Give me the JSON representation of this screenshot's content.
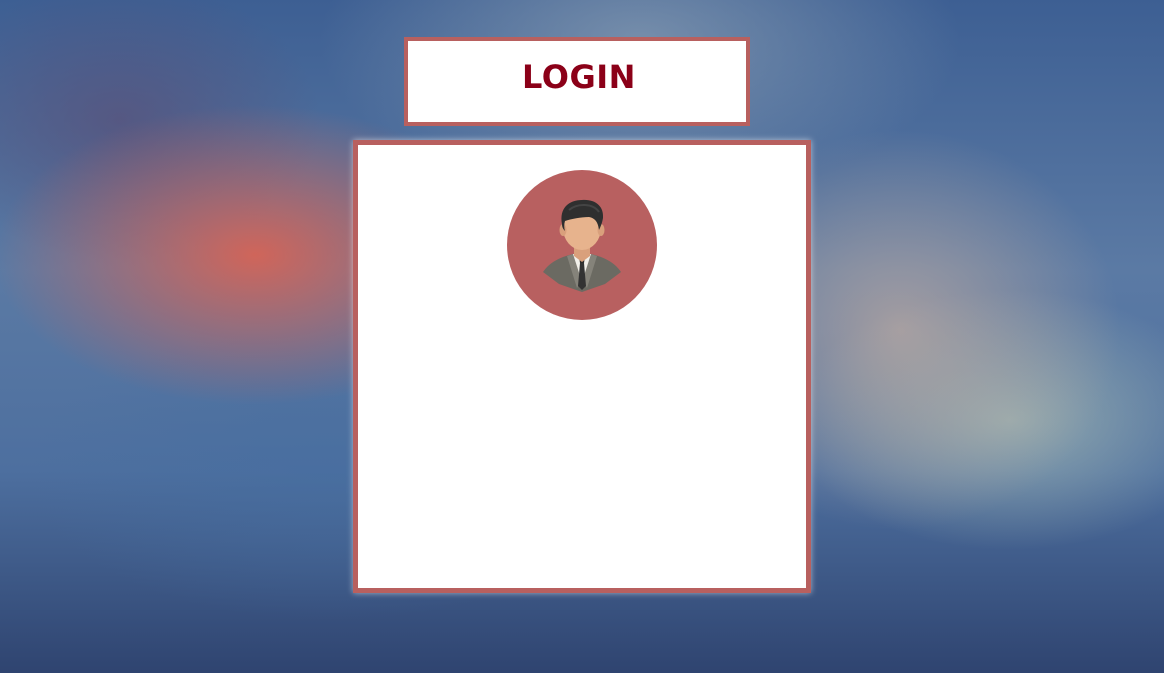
{
  "header": {
    "title": "LOGIN"
  },
  "login_card": {
    "avatar_icon": "user-avatar-icon"
  },
  "colors": {
    "accent_border": "#b8605f",
    "title_text": "#8b0018",
    "avatar_background": "#b86060",
    "card_background": "#ffffff"
  }
}
